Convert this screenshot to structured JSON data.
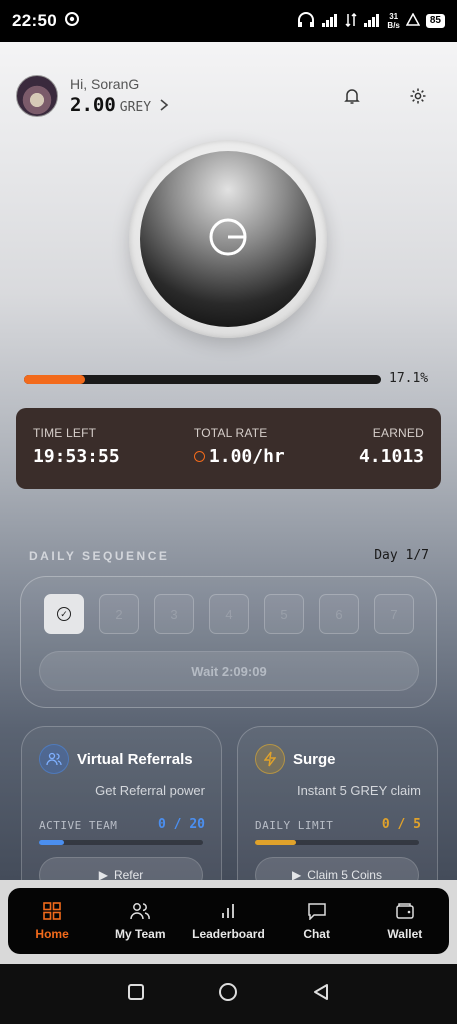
{
  "status_bar": {
    "time": "22:50",
    "net_speed_top": "31",
    "net_speed_bottom": "B/s",
    "battery": "85"
  },
  "header": {
    "greeting": "Hi, SoranG",
    "balance": "2.00",
    "currency": "GREY"
  },
  "mining": {
    "progress_percent": 17.1,
    "progress_label": "17.1%"
  },
  "stats": {
    "time_left_label": "TIME LEFT",
    "time_left_value": "19:53:55",
    "total_rate_label": "TOTAL RATE",
    "total_rate_value": "1.00/hr",
    "earned_label": "EARNED",
    "earned_value": "4.1013"
  },
  "daily_sequence": {
    "title": "DAILY SEQUENCE",
    "day_label": "Day 1/7",
    "days": [
      "1",
      "2",
      "3",
      "4",
      "5",
      "6",
      "7"
    ],
    "wait_label": "Wait 2:09:09"
  },
  "referrals_card": {
    "title": "Virtual Referrals",
    "subtitle": "Get Referral power",
    "stat_label": "ACTIVE TEAM",
    "stat_value": "0 / 20",
    "fill_fraction": 0.15,
    "button_label": "Refer",
    "accent": "#4b8ff0"
  },
  "surge_card": {
    "title": "Surge",
    "subtitle": "Instant 5 GREY claim",
    "stat_label": "DAILY LIMIT",
    "stat_value": "0 / 5",
    "fill_fraction": 0.25,
    "button_label": "Claim 5 Coins",
    "accent": "#e0a22b"
  },
  "nav": {
    "items": [
      {
        "label": "Home",
        "icon": "grid-icon",
        "active": true
      },
      {
        "label": "My Team",
        "icon": "users-icon",
        "active": false
      },
      {
        "label": "Leaderboard",
        "icon": "bar-chart-icon",
        "active": false
      },
      {
        "label": "Chat",
        "icon": "chat-icon",
        "active": false
      },
      {
        "label": "Wallet",
        "icon": "wallet-icon",
        "active": false
      }
    ]
  },
  "colors": {
    "accent": "#f26a1b",
    "stats_bg": "#3a2d2a"
  }
}
